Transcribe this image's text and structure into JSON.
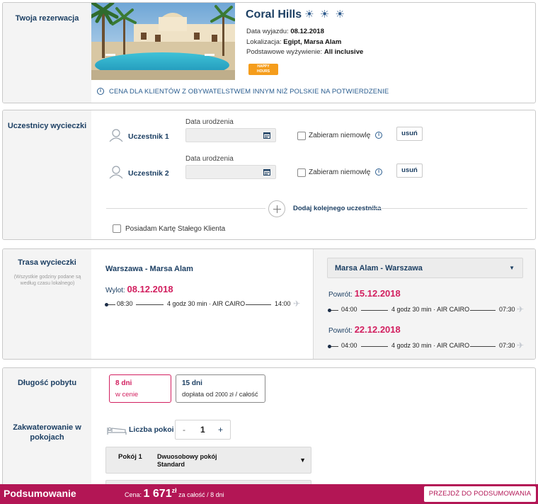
{
  "reservation": {
    "section_title": "Twoja rezerwacja",
    "hotel_name": "Coral Hills",
    "stars_glyph": "☀ ☀ ☀",
    "departure_label": "Data wyjazdu:",
    "departure_value": "08.12.2018",
    "location_label": "Lokalizacja:",
    "location_value": "Egipt, Marsa Alam",
    "board_label": "Podstawowe wyżywienie:",
    "board_value": "All inclusive",
    "badge_line1": "HAPPY",
    "badge_line2": "HOURS",
    "notice": "CENA DLA KLIENTÓW Z OBYWATELSTWEM INNYM NIŻ POLSKIE NA POTWIERDZENIE",
    "info_glyph": "i"
  },
  "participants": {
    "section_title": "Uczestnicy wycieczki",
    "items": [
      {
        "name": "Uczestnik 1",
        "dob_label": "Data urodzenia",
        "dob_value": "",
        "infant_label": "Zabieram niemowlę",
        "remove_label": "usuń"
      },
      {
        "name": "Uczestnik 2",
        "dob_label": "Data urodzenia",
        "dob_value": "",
        "infant_label": "Zabieram niemowlę",
        "remove_label": "usuń"
      }
    ],
    "add_label": "Dodaj kolejnego uczestnika",
    "loyalty_label": "Posiadam Kartę Stałego Klienta"
  },
  "route": {
    "section_title": "Trasa wycieczki",
    "section_note": "(Wszystkie godziny podane są według czasu lokalnego)",
    "outbound": {
      "title": "Warszawa - Marsa Alam",
      "date_label": "Wylot:",
      "date": "08.12.2018",
      "dep_time": "08:30",
      "duration": "4 godz 30 min",
      "sep": "·",
      "airline": "AIR CAIRO",
      "arr_time": "14:00"
    },
    "return": {
      "selected": "Marsa Alam - Warszawa",
      "options": [
        {
          "date_label": "Powrót:",
          "date": "15.12.2018",
          "dep_time": "04:00",
          "duration": "4 godz 30 min",
          "sep": "·",
          "airline": "AIR CAIRO",
          "arr_time": "07:30"
        },
        {
          "date_label": "Powrót:",
          "date": "22.12.2018",
          "dep_time": "04:00",
          "duration": "4 godz 30 min",
          "sep": "·",
          "airline": "AIR CAIRO",
          "arr_time": "07:30"
        }
      ]
    }
  },
  "stay": {
    "section_title": "Długość pobytu",
    "options": [
      {
        "days": "8 dni",
        "note": "w cenie",
        "selected": true
      },
      {
        "days": "15 dni",
        "note_prefix": "dopłata od",
        "note_amount": "2000 zł",
        "note_suffix": "/ całość",
        "selected": false
      }
    ],
    "accommodation_title": "Zakwaterowanie w pokojach",
    "rooms_label": "Liczba pokoi",
    "rooms_minus": "-",
    "rooms_count": "1",
    "rooms_plus": "+",
    "room_label": "Pokój 1",
    "room_type": "Dwuosobowy pokój Standard"
  },
  "footer": {
    "title": "Podsumowanie",
    "price_label": "Cena:",
    "price_amount": "1 671",
    "price_currency": "zł",
    "price_suffix": "za całość / 8 dni",
    "cta_label": "PRZEJDŹ DO PODSUMOWANIA"
  },
  "colors": {
    "brand": "#b31655",
    "accent_pink": "#d21f5f",
    "navy": "#1c3f63",
    "badge_orange": "#f59d1c"
  }
}
